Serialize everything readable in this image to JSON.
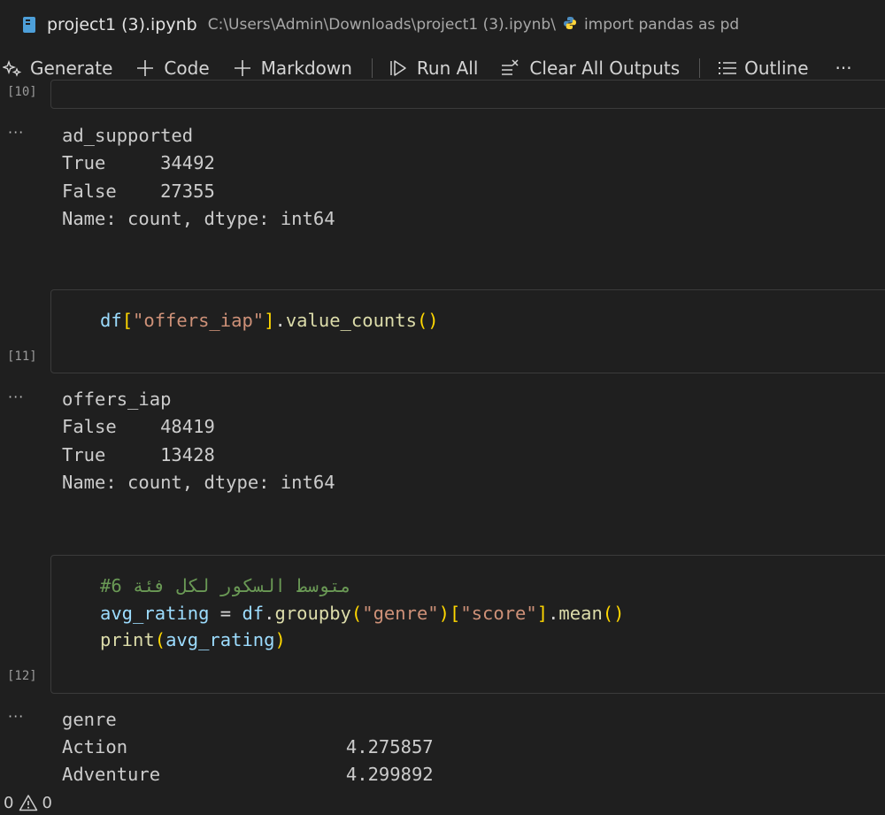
{
  "breadcrumb": {
    "file_name": "project1 (3).ipynb",
    "path": "C:\\Users\\Admin\\Downloads\\project1 (3).ipynb\\",
    "cell_name": "import pandas as pd",
    "notebook_icon": "notebook-icon",
    "python_icon": "python-icon"
  },
  "toolbar": {
    "generate": "Generate",
    "code": "Code",
    "markdown": "Markdown",
    "run_all": "Run All",
    "clear_all": "Clear All Outputs",
    "outline": "Outline",
    "more": "···"
  },
  "cells": [
    {
      "exec_count": "[10]",
      "output_menu": "···",
      "output": [
        "ad_supported",
        "True     34492",
        "False    27355",
        "Name: count, dtype: int64"
      ]
    },
    {
      "exec_count": "[11]",
      "code": {
        "t1": "df",
        "t2": "[",
        "t3": "\"offers_iap\"",
        "t4": "]",
        "t5": ".",
        "t6": "value_counts",
        "t7": "()"
      },
      "output_menu": "···",
      "output": [
        "offers_iap",
        "False    48419",
        "True     13428",
        "Name: count, dtype: int64"
      ]
    },
    {
      "exec_count": "[12]",
      "code": {
        "comment": "#6 متوسط السكور لكل فئة",
        "l2": {
          "t1": "avg_rating",
          "t2": " = ",
          "t3": "df",
          "t4": ".",
          "t5": "groupby",
          "t6": "(",
          "t7": "\"genre\"",
          "t8": ")",
          "t9": "[",
          "t10": "\"score\"",
          "t11": "]",
          "t12": ".",
          "t13": "mean",
          "t14": "()"
        },
        "l3": {
          "t1": "print",
          "t2": "(",
          "t3": "avg_rating",
          "t4": ")"
        }
      },
      "output_menu": "···",
      "output": [
        "genre",
        "Action                    4.275857",
        "Adventure                 4.299892"
      ]
    }
  ],
  "status": {
    "errors": "0",
    "warnings": "0"
  }
}
